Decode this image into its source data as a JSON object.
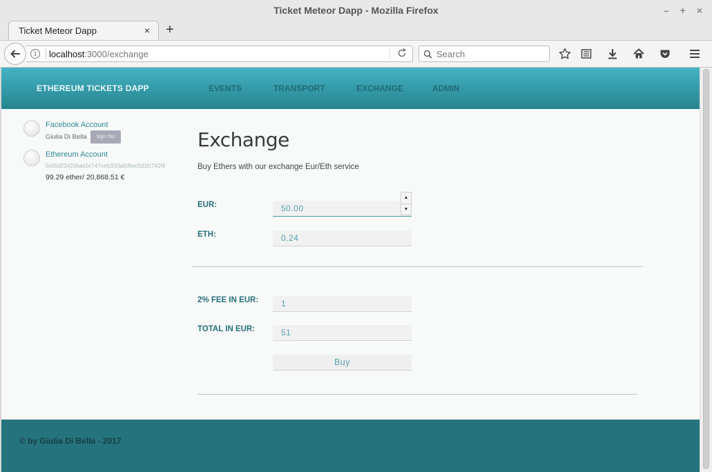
{
  "window": {
    "title": "Ticket Meteor Dapp - Mozilla Firefox",
    "controls": [
      "–",
      "+",
      "×"
    ]
  },
  "browser": {
    "tab_title": "Ticket Meteor Dapp",
    "tab_close": "×",
    "new_tab": "+",
    "url_host": "localhost",
    "url_path": ":3000/exchange",
    "search_placeholder": "Search"
  },
  "app": {
    "brand": "ETHEREUM TICKETS DAPP",
    "nav": [
      "EVENTS",
      "TRANSPORT",
      "EXCHANGE",
      "ADMIN"
    ]
  },
  "sidebar": {
    "facebook_title": "Facebook Account",
    "facebook_user": "Giulia Di Bella",
    "signout_label": "Sign Out",
    "ethereum_title": "Ethereum Account",
    "eth_address": "0x05d224206ae1e747cefc933afcf6ac5d1fc742f4",
    "balance": "99.29 ether/ 20,868.51 €"
  },
  "exchange": {
    "title": "Exchange",
    "description": "Buy Ethers with our exchange Eur/Eth service",
    "eur_label": "EUR:",
    "eur_value": "50.00",
    "eth_label": "ETH:",
    "eth_value": "0.24",
    "fee_label": "2% FEE IN EUR:",
    "fee_value": "1",
    "total_label": "TOTAL IN EUR:",
    "total_value": "51",
    "buy_label": "Buy"
  },
  "footer": {
    "text": "© by Giulia Di Bella - 2017"
  },
  "colors": {
    "header_top": "#44b2c3",
    "header_bottom": "#26848f",
    "footer": "#25737d",
    "label": "#26707c",
    "link": "#2f8a96"
  }
}
